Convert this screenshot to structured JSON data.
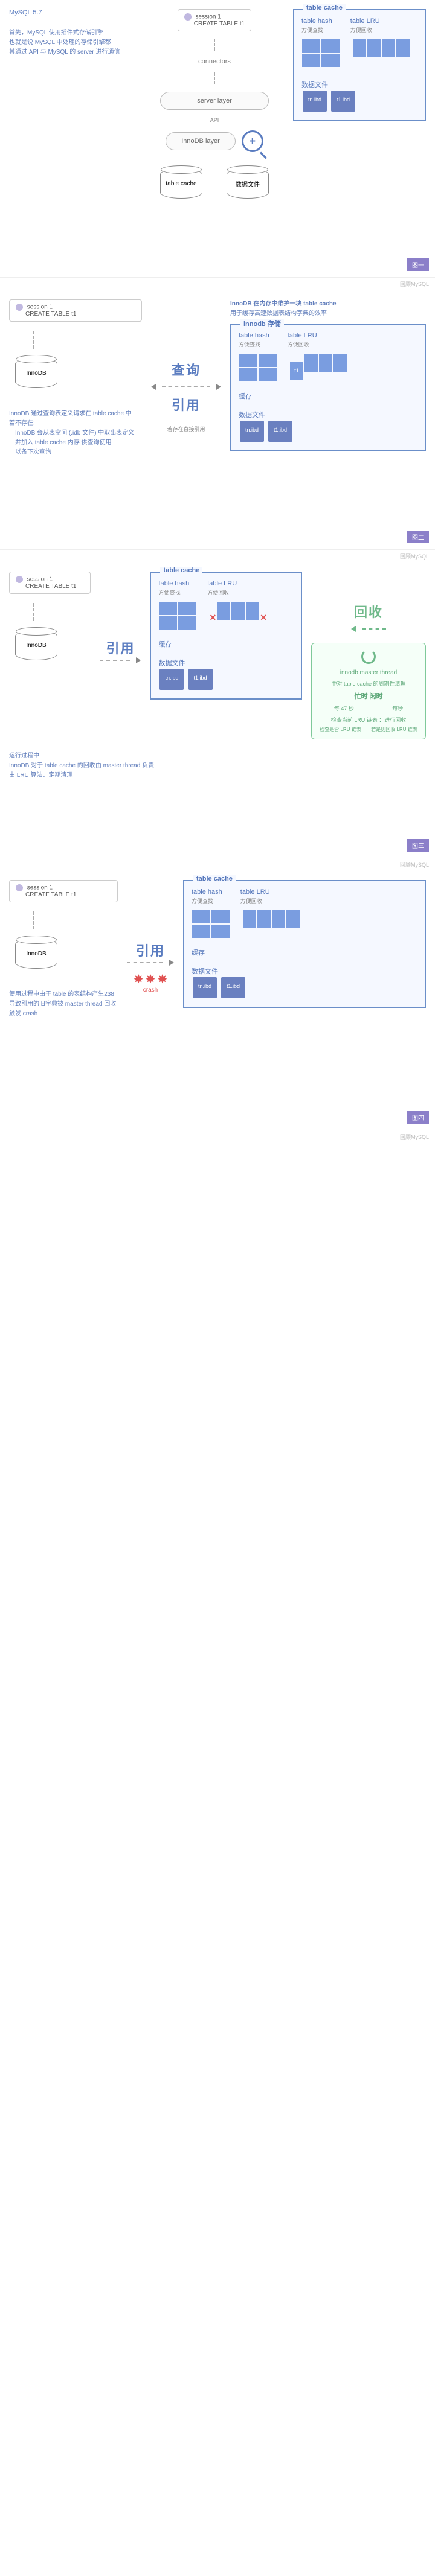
{
  "watermark": "回顾MySQL",
  "mysql_label": "MySQL 5.7",
  "connectors": "connectors",
  "server_layer": "server layer",
  "innodb_layer": "InnoDB layer",
  "api_label": "API",
  "session_title": "session 1",
  "session_sql": "CREATE TABLE t1",
  "panel1": {
    "tag": "图一",
    "notes": [
      "首先，MySQL 使用插件式存储引擎",
      "也就是说 MySQL 中处理的存储引擎都",
      "其通过 API 与 MySQL 的 server 进行通信"
    ],
    "cache_title": "table cache",
    "hash_label": "table hash",
    "hash_sub": "方便查找",
    "lru_label": "table LRU",
    "lru_sub": "方便回收",
    "files_label": "数据文件",
    "file1": "tn.ibd",
    "file2": "t1.ibd",
    "store_label": "table cache",
    "store_sub": "数据文件"
  },
  "panel2": {
    "tag": "图二",
    "query": "查询",
    "ref": "引用",
    "desc_title": "InnoDB 在内存中维护一块 table cache",
    "desc_sub": "用于缓存高速数据表结构字典的效率",
    "na_label": "若存在直接引用",
    "notes": [
      "InnoDB 通过查询表定义请求在 table cache 中",
      "若不存在:",
      "InnoDB 会从表空间 (.idb 文件) 中取出表定义",
      "并加入 table cache 内存 供查询使用",
      "以备下次查询"
    ],
    "cache_title": "innodb 存储",
    "mem_label": "缓存",
    "lru_t1": "t1"
  },
  "panel3": {
    "tag": "图三",
    "ref": "引用",
    "recycle": "回收",
    "green_title": "innodb master thread",
    "g1": "中对 table cache 的周期性清理",
    "g2": "忙时 闲时",
    "g3a": "每 47 秒",
    "g3b": "每秒",
    "g4": "检查当前 LRU 链表 ：进行回收",
    "g5a": "检查是否 LRU 链表",
    "g5b": "若是则回收 LRU 链表",
    "notes": [
      "运行过程中",
      "InnoDB 对于 table cache 的回收由 master thread 负责",
      "由 LRU 算法、定期清理"
    ]
  },
  "panel4": {
    "tag": "图四",
    "ref": "引用",
    "crash": "crash",
    "notes": [
      "使用过程中由于 table 的表结构产生238",
      "导致引用的旧字典被 master thread 回收",
      "触发 crash"
    ]
  },
  "common": {
    "cache_title": "table cache",
    "hash": "table hash",
    "hash_sub": "方便查找",
    "lru": "table LRU",
    "lru_sub": "方便回收",
    "files": "数据文件",
    "f1": "tn.ibd",
    "f2": "t1.ibd",
    "mem": "缓存",
    "innodb": "InnoDB"
  }
}
